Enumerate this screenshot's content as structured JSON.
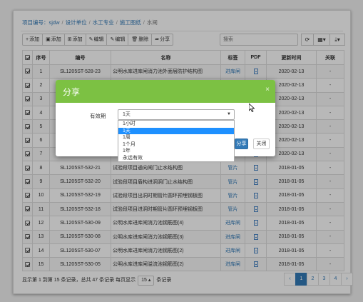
{
  "breadcrumb": {
    "project_label": "项目编号：sjdw",
    "items": [
      "设计单位",
      "水工专业",
      "施工图纸"
    ],
    "current": "水闸"
  },
  "toolbar": {
    "buttons": [
      {
        "icon": "+",
        "label": "添加"
      },
      {
        "icon": "▣",
        "label": "添加"
      },
      {
        "icon": "⊞",
        "label": "添加"
      },
      {
        "icon": "✎",
        "label": "编辑"
      },
      {
        "icon": "✎",
        "label": "编辑"
      },
      {
        "icon": "🗑",
        "label": "删除"
      },
      {
        "icon": "➦",
        "label": "分享"
      }
    ]
  },
  "search": {
    "placeholder": "搜索"
  },
  "right_buttons": {
    "refresh_icon": "⟳",
    "columns_icon": "▦▾",
    "export_icon": "⤓▾"
  },
  "table": {
    "headers": [
      "",
      "序号",
      "编号",
      "名称",
      "标签",
      "PDF",
      "更新时间",
      "关联"
    ],
    "rows": [
      {
        "checked": true,
        "no": "1",
        "code": "SL1205ST-528-23",
        "name": "公明水库进库闸消力池外面层防护结构图",
        "tag": "进库闸",
        "date": "2020-02-13",
        "link": "-"
      },
      {
        "checked": true,
        "no": "2",
        "code": "",
        "name": "",
        "tag": "",
        "date": "2020-02-13",
        "link": "-"
      },
      {
        "checked": true,
        "no": "3",
        "code": "",
        "name": "",
        "tag": "",
        "date": "2020-02-13",
        "link": "-"
      },
      {
        "checked": true,
        "no": "4",
        "code": "",
        "name": "",
        "tag": "",
        "date": "2020-02-13",
        "link": "-"
      },
      {
        "checked": true,
        "no": "5",
        "code": "",
        "name": "",
        "tag": "",
        "date": "2020-02-13",
        "link": "-"
      },
      {
        "checked": true,
        "no": "6",
        "code": "",
        "name": "",
        "tag": "",
        "date": "2020-02-13",
        "link": "-"
      },
      {
        "checked": true,
        "no": "7",
        "code": "",
        "name": "",
        "tag": "",
        "date": "2020-02-13",
        "link": "-"
      },
      {
        "checked": true,
        "no": "8",
        "code": "SL1205ST-532-21",
        "name": "试验段项目通向闸门止水结构图",
        "tag": "管片",
        "date": "2018-01-05",
        "link": "-"
      },
      {
        "checked": true,
        "no": "9",
        "code": "SL1205ST-532-20",
        "name": "试验段项目盾构进洞洞门止水结构图",
        "tag": "管片",
        "date": "2018-01-05",
        "link": "-"
      },
      {
        "checked": true,
        "no": "10",
        "code": "SL1205ST-532-19",
        "name": "试验段项目出洞时期管片圆环预埋钢板图",
        "tag": "管片",
        "date": "2018-01-05",
        "link": "-"
      },
      {
        "checked": true,
        "no": "11",
        "code": "SL1205ST-532-18",
        "name": "试验段项目进洞时期管片圆环预埋钢板图",
        "tag": "管片",
        "date": "2018-01-05",
        "link": "-"
      },
      {
        "checked": true,
        "no": "12",
        "code": "SL1205ST-530-09",
        "name": "公明水库进库闸消力池钢筋图(4)",
        "tag": "进库闸",
        "date": "2018-01-05",
        "link": "-"
      },
      {
        "checked": true,
        "no": "13",
        "code": "SL1205ST-530-08",
        "name": "公明水库进库闸消力池钢筋图(3)",
        "tag": "进库闸",
        "date": "2018-01-05",
        "link": "-"
      },
      {
        "checked": true,
        "no": "14",
        "code": "SL1205ST-530-07",
        "name": "公明水库进库闸消力池钢筋图(2)",
        "tag": "进库闸",
        "date": "2018-01-05",
        "link": "-"
      },
      {
        "checked": true,
        "no": "15",
        "code": "SL1205ST-530-05",
        "name": "公明水库进库闸溢流池钢筋图(2)",
        "tag": "进库闸",
        "date": "2018-01-05",
        "link": "-"
      }
    ]
  },
  "footer": {
    "info_prefix": "显示第 1 到第 15 条记录，总共 47 条记录 每页显示",
    "page_size": "15",
    "info_suffix": "条记录",
    "pages": [
      "‹",
      "1",
      "2",
      "3",
      "4",
      "›"
    ],
    "active_page": "1"
  },
  "modal": {
    "title": "分享",
    "close_icon": "×",
    "field_label": "有效期",
    "selected_value": "1天",
    "options": [
      "1小时",
      "1天",
      "1周",
      "1个月",
      "1年",
      "永远有效"
    ],
    "highlighted_option": "1天",
    "share_button": "分享",
    "close_button": "关闭"
  },
  "colors": {
    "modal_header": "#7cc143",
    "primary": "#337ab7",
    "dropdown_highlight": "#1e90ff"
  }
}
